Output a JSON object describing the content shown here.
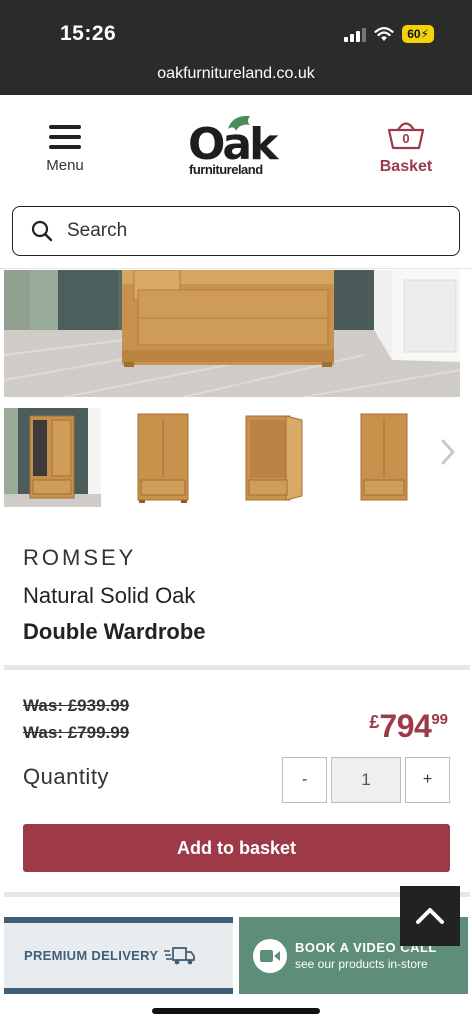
{
  "status_bar": {
    "time": "15:26",
    "battery": "60",
    "url": "oakfurnitureland.co.uk",
    "icons": [
      "signal-icon",
      "wifi-icon",
      "battery-icon"
    ]
  },
  "header": {
    "menu_label": "Menu",
    "logo_main": "Oak",
    "logo_sub": "furnitureland",
    "basket_label": "Basket",
    "basket_count": "0"
  },
  "search": {
    "placeholder": "Search"
  },
  "product": {
    "brand": "ROMSEY",
    "subtitle": "Natural Solid Oak",
    "name": "Double Wardrobe"
  },
  "pricing": {
    "was_1": "Was: £939.99",
    "was_2": "Was: £799.99",
    "currency": "£",
    "price_main": "794",
    "price_decimals": "99"
  },
  "quantity": {
    "label": "Quantity",
    "minus": "-",
    "value": "1",
    "plus": "+"
  },
  "add_to_basket": "Add to basket",
  "banners": {
    "delivery": "PREMIUM DELIVERY",
    "video_title": "BOOK A VIDEO CALL",
    "video_sub": "see our products in-store"
  },
  "colors": {
    "brand_red": "#9e3a48",
    "delivery_blue": "#3f5f78",
    "video_green": "#5e8d78",
    "leaf_green": "#4d8a5a"
  }
}
